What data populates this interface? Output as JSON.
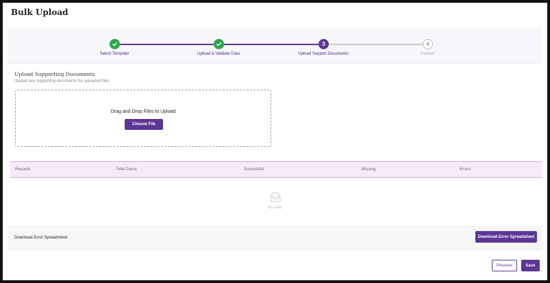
{
  "page": {
    "title": "Bulk Upload"
  },
  "stepper": {
    "steps": [
      {
        "label": "Select Template",
        "status": "done"
      },
      {
        "label": "Upload & Validate Data",
        "status": "done"
      },
      {
        "label": "Upload Support Documents",
        "status": "active",
        "number": "3"
      },
      {
        "label": "Review",
        "status": "pending",
        "number": "4"
      }
    ],
    "colors": {
      "done": "#27a745",
      "active": "#5c3795",
      "pending": "#bdbdbd"
    }
  },
  "upload": {
    "title": "Upload Supporting Documents",
    "subtitle": "Upload any supporting documents for uploaded files.",
    "dropzone_text": "Drag and Drop Files to Upload",
    "choose_label": "Choose File"
  },
  "table": {
    "columns": [
      "Records",
      "Total Count",
      "Successful",
      "Missing",
      "Errors"
    ],
    "empty_text": "No Data",
    "empty_icon": "inbox-icon"
  },
  "download": {
    "label": "Download Error Spreadsheet",
    "button_label": "Download Error Spreadsheet"
  },
  "footer": {
    "previous_label": "Previous",
    "save_label": "Save"
  },
  "theme": {
    "accent": "#5c3795",
    "header_bg": "#f6eaf8"
  }
}
